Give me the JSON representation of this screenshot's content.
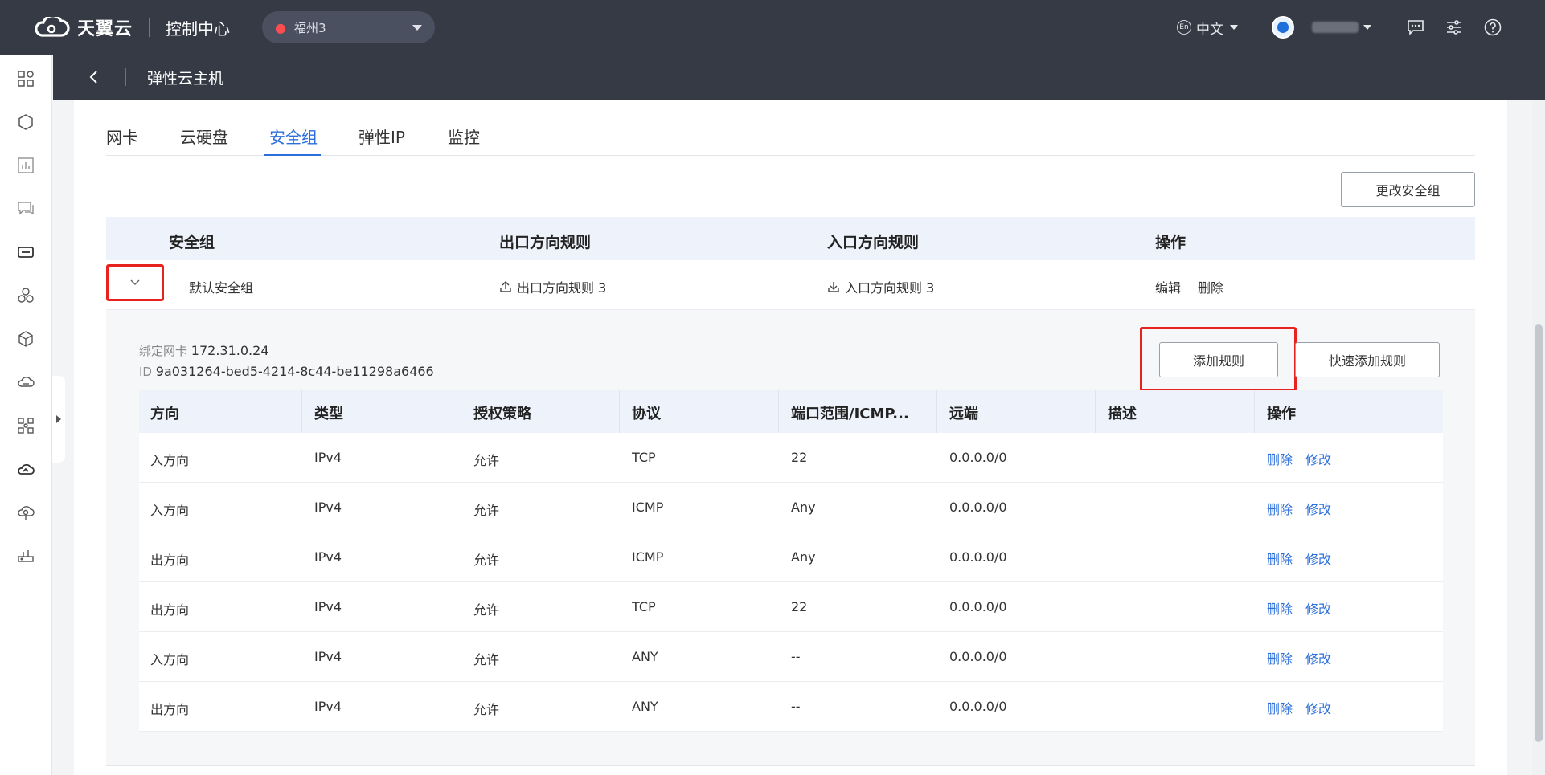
{
  "topbar": {
    "brand": "天翼云",
    "console_title": "控制中心",
    "region": "福州3",
    "language": "中文",
    "language_badge": "En"
  },
  "subheader": {
    "title": "弹性云主机"
  },
  "tabs": [
    {
      "label": "网卡"
    },
    {
      "label": "云硬盘"
    },
    {
      "label": "安全组"
    },
    {
      "label": "弹性IP"
    },
    {
      "label": "监控"
    }
  ],
  "change_sg_button": "更改安全组",
  "sg_table": {
    "headers": [
      "安全组",
      "出口方向规则",
      "入口方向规则",
      "操作"
    ],
    "row": {
      "name": "默认安全组",
      "egress": "出口方向规则 3",
      "ingress": "入口方向规则 3",
      "edit": "编辑",
      "delete": "删除"
    }
  },
  "detail": {
    "nic_label": "绑定网卡",
    "nic_value": "172.31.0.24",
    "id_label": "ID",
    "id_value": "9a031264-bed5-4214-8c44-be11298a6466",
    "add_rule_button": "添加规则",
    "quick_add_button": "快速添加规则"
  },
  "rules_table": {
    "headers": [
      "方向",
      "类型",
      "授权策略",
      "协议",
      "端口范围/ICMP...",
      "远端",
      "描述",
      "操作"
    ],
    "action_delete": "删除",
    "action_modify": "修改",
    "rows": [
      [
        "入方向",
        "IPv4",
        "允许",
        "TCP",
        "22",
        "0.0.0.0/0",
        ""
      ],
      [
        "入方向",
        "IPv4",
        "允许",
        "ICMP",
        "Any",
        "0.0.0.0/0",
        ""
      ],
      [
        "出方向",
        "IPv4",
        "允许",
        "ICMP",
        "Any",
        "0.0.0.0/0",
        ""
      ],
      [
        "出方向",
        "IPv4",
        "允许",
        "TCP",
        "22",
        "0.0.0.0/0",
        ""
      ],
      [
        "入方向",
        "IPv4",
        "允许",
        "ANY",
        "--",
        "0.0.0.0/0",
        ""
      ],
      [
        "出方向",
        "IPv4",
        "允许",
        "ANY",
        "--",
        "0.0.0.0/0",
        ""
      ]
    ]
  },
  "colors": {
    "topbar_bg": "#353a45",
    "accent": "#2c6fdc",
    "highlight_red": "#e8231f"
  },
  "sidebar_icons": [
    "dashboard-icon",
    "cube-icon",
    "chart-icon",
    "message-icon",
    "server-icon",
    "cluster-icon",
    "box-icon",
    "cloud-disk-icon",
    "network-icon",
    "cloud-icon",
    "cloud-sync-icon",
    "router-icon"
  ]
}
